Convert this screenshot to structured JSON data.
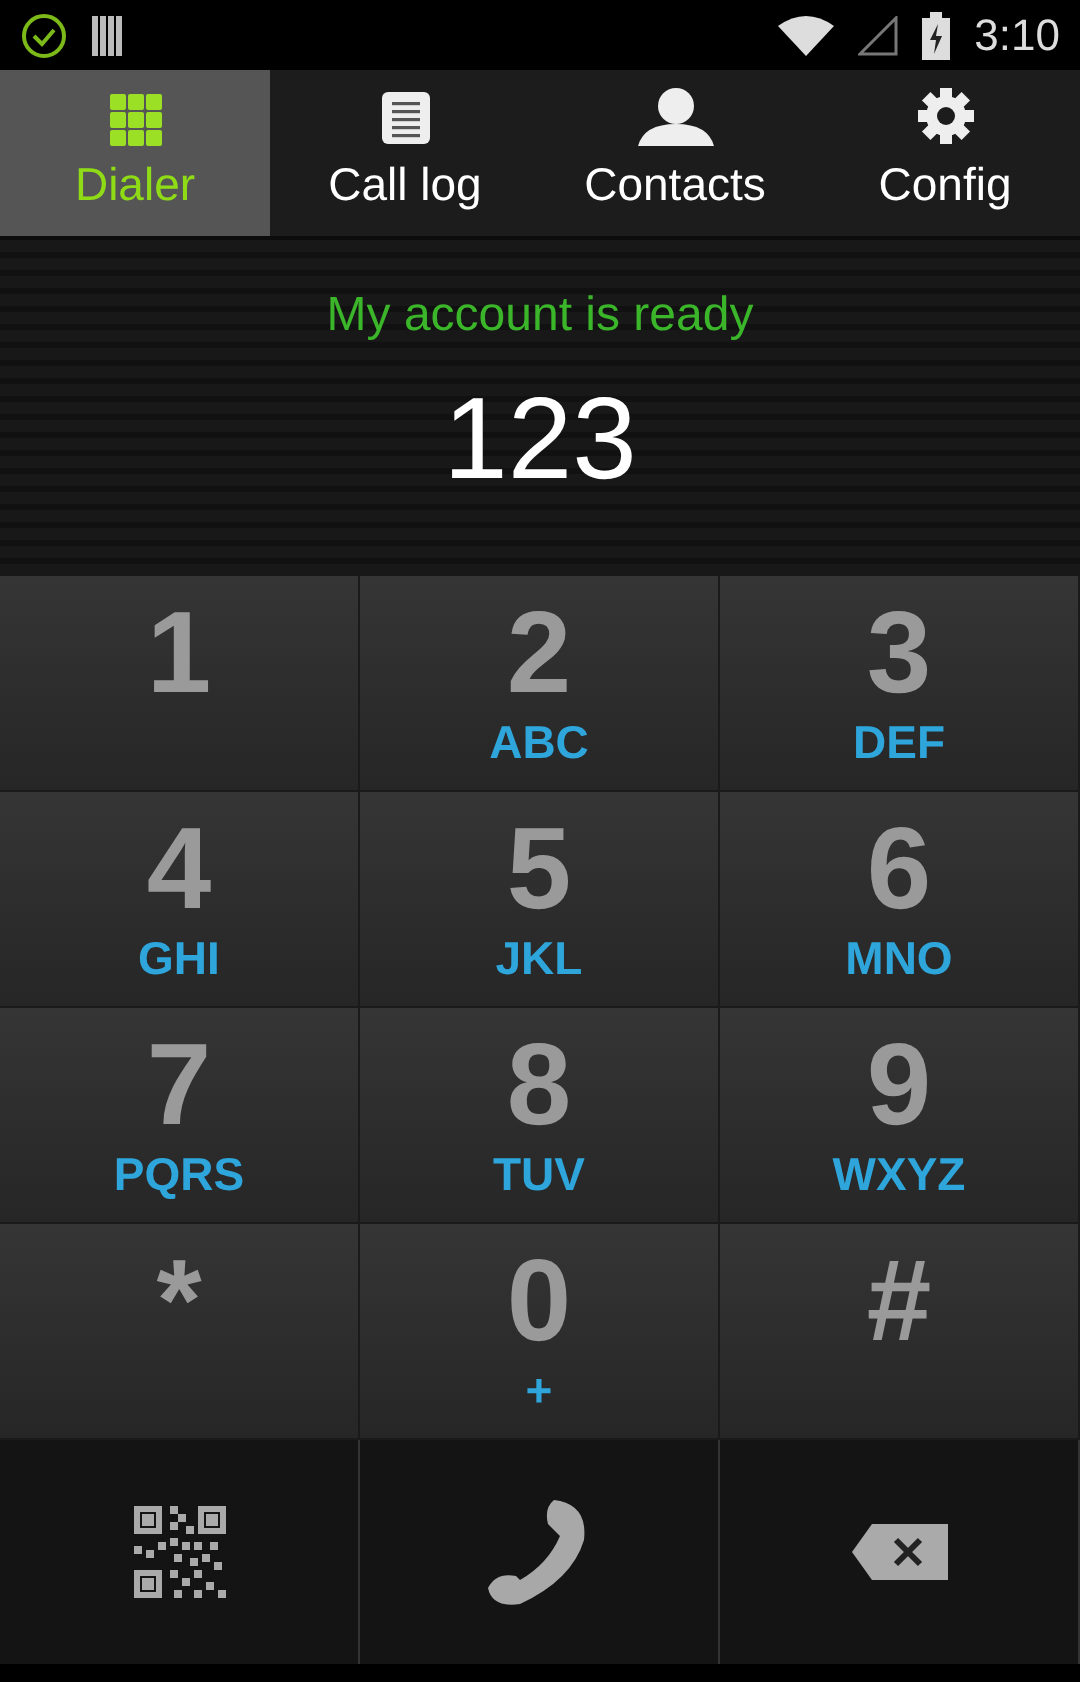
{
  "status_bar": {
    "time": "3:10"
  },
  "tabs": [
    {
      "label": "Dialer",
      "selected": true
    },
    {
      "label": "Call log",
      "selected": false
    },
    {
      "label": "Contacts",
      "selected": false
    },
    {
      "label": "Config",
      "selected": false
    }
  ],
  "account_status": "My account is ready",
  "number_display": "123",
  "keypad": [
    {
      "digit": "1"
    },
    {
      "digit": "2",
      "letters": "ABC"
    },
    {
      "digit": "3",
      "letters": "DEF"
    },
    {
      "digit": "4",
      "letters": "GHI"
    },
    {
      "digit": "5",
      "letters": "JKL"
    },
    {
      "digit": "6",
      "letters": "MNO"
    },
    {
      "digit": "7",
      "letters": "PQRS"
    },
    {
      "digit": "8",
      "letters": "TUV"
    },
    {
      "digit": "9",
      "letters": "WXYZ"
    },
    {
      "digit": "*"
    },
    {
      "digit": "0",
      "letters": "+"
    },
    {
      "digit": "#"
    }
  ]
}
